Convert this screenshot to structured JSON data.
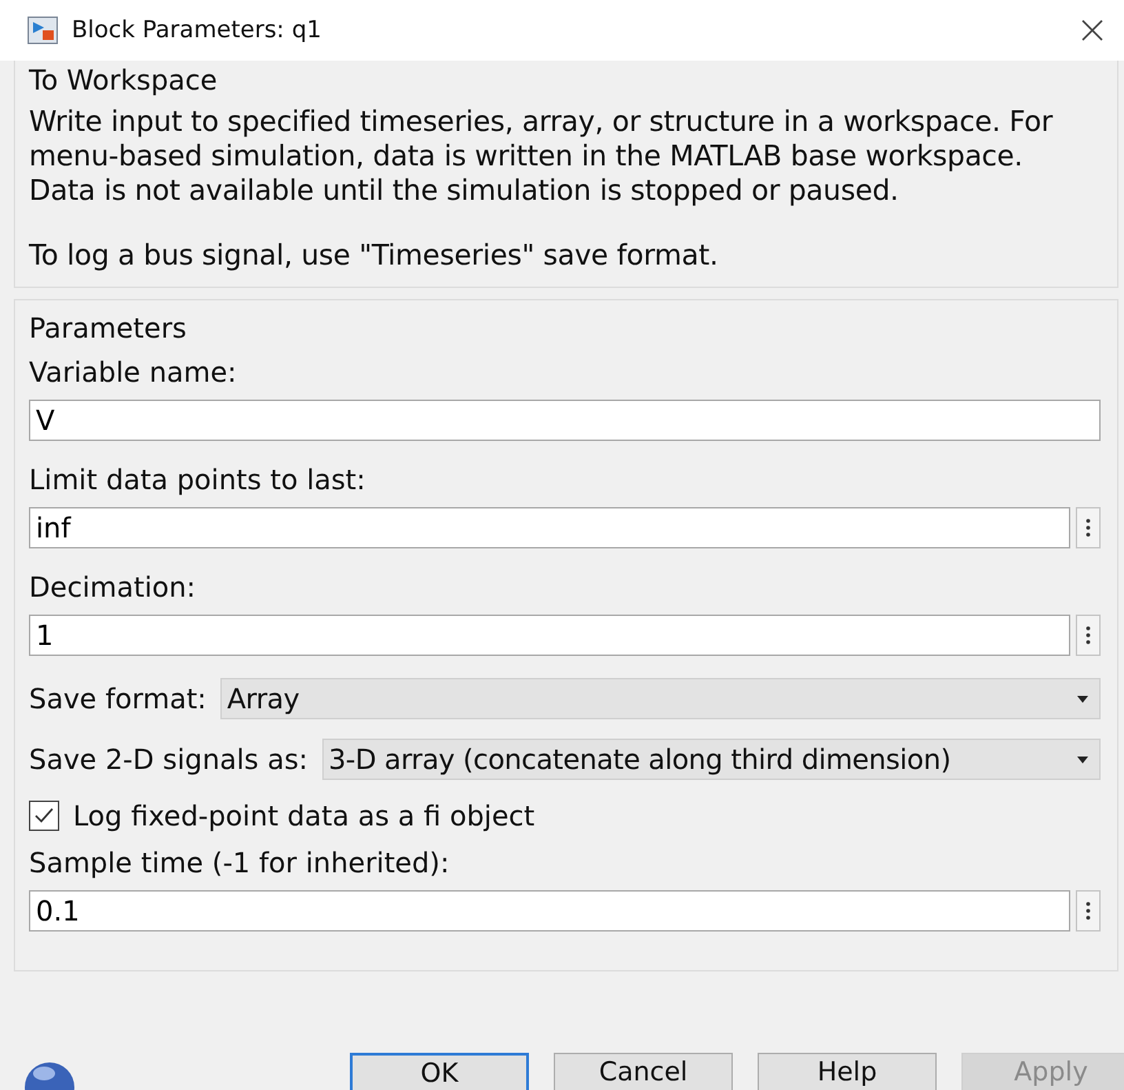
{
  "window": {
    "title": "Block Parameters: q1"
  },
  "description_group": {
    "title": "To Workspace",
    "paragraphs": [
      [
        "Write input to specified timeseries, array, or structure in a workspace. For",
        "menu-based simulation, data is written in the MATLAB base workspace.",
        "Data is not available until the simulation is stopped or paused."
      ],
      [
        "To log a bus signal, use \"Timeseries\" save format."
      ]
    ]
  },
  "parameters": {
    "title": "Parameters",
    "items": [
      {
        "kind": "text",
        "label": "Variable name:",
        "value": "V",
        "menu_button": false
      },
      {
        "kind": "text",
        "label": "Limit data points to last:",
        "value": "inf",
        "menu_button": true
      },
      {
        "kind": "text",
        "label": "Decimation:",
        "value": "1",
        "menu_button": true
      },
      {
        "kind": "dropdown",
        "label": "Save format:",
        "value": "Array"
      },
      {
        "kind": "dropdown",
        "label": "Save 2-D signals as:",
        "value": "3-D array (concatenate along third dimension)"
      },
      {
        "kind": "checkbox",
        "label": "Log fixed-point data as a fi object",
        "checked": true
      },
      {
        "kind": "text",
        "label": "Sample time (-1 for inherited):",
        "value": "0.1",
        "menu_button": true
      }
    ]
  },
  "buttons": [
    {
      "label": "OK",
      "disabled": false,
      "default": true
    },
    {
      "label": "Cancel",
      "disabled": false,
      "default": false
    },
    {
      "label": "Help",
      "disabled": false,
      "default": false
    },
    {
      "label": "Apply",
      "disabled": true,
      "default": false
    }
  ]
}
